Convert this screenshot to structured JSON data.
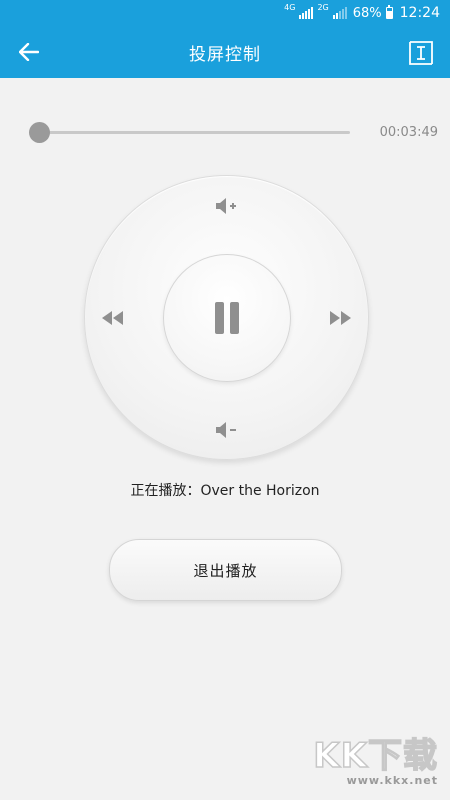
{
  "status_bar": {
    "network_1": "4G",
    "network_2": "2G",
    "battery": "68%",
    "battery_level": 0.68,
    "time": "12:24"
  },
  "app_bar": {
    "title": "投屏控制",
    "back_icon": "arrow-left-icon",
    "device_icon": "device-list-icon"
  },
  "player": {
    "progress": 0,
    "duration": "00:03:49",
    "state": "playing",
    "now_playing_label": "正在播放：Over the Horizon",
    "controls": {
      "volume_up_icon": "volume-up-icon",
      "volume_down_icon": "volume-down-icon",
      "rewind_icon": "rewind-icon",
      "forward_icon": "fast-forward-icon",
      "pause_icon": "pause-icon"
    }
  },
  "exit_button_label": "退出播放",
  "watermark": {
    "logo": "KK下载",
    "url": "www.kkx.net"
  },
  "colors": {
    "primary": "#1aa0dc",
    "background": "#f2f2f2",
    "icon_gray": "#8f8f8f"
  }
}
